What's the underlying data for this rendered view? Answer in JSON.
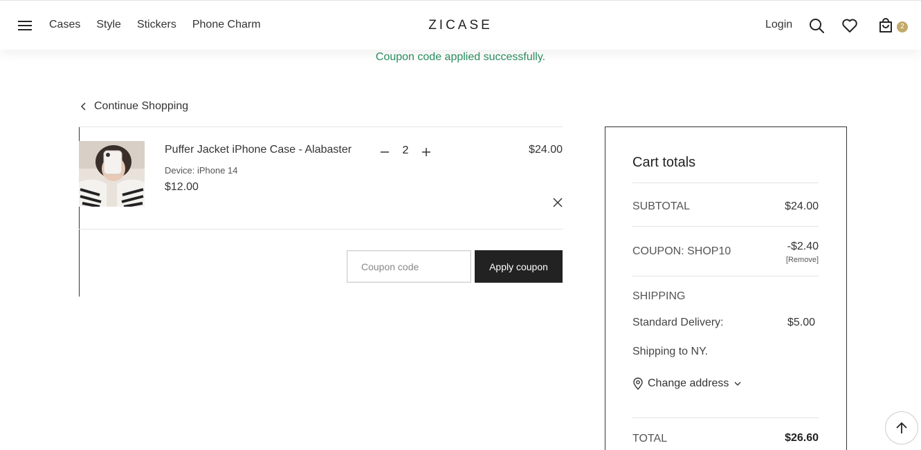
{
  "header": {
    "nav": [
      "Cases",
      "Style",
      "Stickers",
      "Phone Charm"
    ],
    "logo": "ZICASE",
    "login": "Login",
    "cart_count": "2"
  },
  "notice": "Coupon code applied successfully.",
  "continue_label": "Continue Shopping",
  "cart_item": {
    "name": "Puffer Jacket iPhone Case - Alabaster",
    "device": "Device:  iPhone 14",
    "price": "$12.00",
    "quantity": "2",
    "line_total": "$24.00"
  },
  "coupon": {
    "placeholder": "Coupon code",
    "button": "Apply coupon"
  },
  "totals": {
    "title": "Cart totals",
    "subtotal_label": "SUBTOTAL",
    "subtotal_value": "$24.00",
    "coupon_label": "COUPON: SHOP10",
    "coupon_value": "-$2.40",
    "coupon_remove": "[Remove]",
    "shipping_label": "SHIPPING",
    "delivery_label": "Standard Delivery:",
    "delivery_value": "$5.00",
    "shipping_to": "Shipping to NY.",
    "change_address": "Change address",
    "total_label": "TOTAL",
    "total_value": "$26.60"
  },
  "colors": {
    "notice_green": "#2a8f5f",
    "badge_gold": "#c2a96b",
    "button_dark": "#222222"
  }
}
